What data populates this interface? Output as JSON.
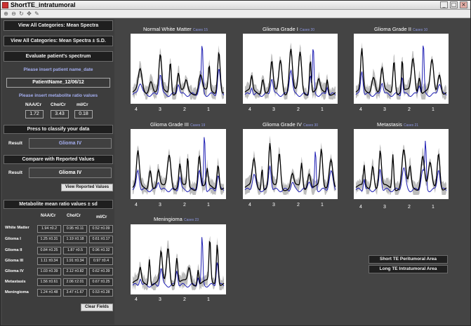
{
  "window": {
    "title": "ShortTE_intratumoral",
    "controls": [
      "_",
      "□",
      "×"
    ]
  },
  "toolbar": {
    "tools": [
      "zoom-in-icon",
      "zoom-out-icon",
      "rotate-icon",
      "pan-icon",
      "data-cursor-icon"
    ],
    "glyphs": [
      "⊕",
      "⊖",
      "↻",
      "✥",
      "✎"
    ]
  },
  "left_panel": {
    "btn_mean_spectra": "View All Categories: Mean Spectra",
    "btn_mean_spectra_sd": "View All Categories: Mean Spectra ± S.D.",
    "btn_evaluate": "Evaluate patient's spectrum",
    "insert_name_label": "Please insert patient name_date",
    "patient_name": "PatientName_12/06/12",
    "insert_ratio_label": "Please insert metabolite ratio values",
    "ratio_headers": [
      "NAA/Cr",
      "Cho/Cr",
      "mI/Cr"
    ],
    "ratio_values": [
      "1.72",
      "3.43",
      "0.18"
    ],
    "btn_classify": "Press to classify your data",
    "result_label": "Result",
    "classify_result": "Glioma IV",
    "btn_compare": "Compare with Reported Values",
    "result_label_2": "Result",
    "compare_result": "Glioma IV",
    "btn_view_reported": "View Reported Values",
    "mean_ratio_header": "Metabolite mean ratio values ± sd",
    "table_headers": [
      "NAA/Cr",
      "Cho/Cr",
      "mI/Cr"
    ],
    "table_rows": [
      {
        "label": "White Matter",
        "values": [
          "1.94 ±0.2",
          "0.95 ±0.11",
          "0.52 ±0.09"
        ]
      },
      {
        "label": "Glioma I",
        "values": [
          "1.25 ±0.31",
          "1.19 ±0.18",
          "0.61 ±0.17"
        ]
      },
      {
        "label": "Glioma II",
        "values": [
          "0.84 ±0.25",
          "1.87 ±0.5",
          "0.96 ±0.32"
        ]
      },
      {
        "label": "Glioma III",
        "values": [
          "1.11 ±0.34",
          "1.91 ±0.34",
          "0.97 ±0.4"
        ]
      },
      {
        "label": "Glioma IV",
        "values": [
          "1.03 ±0.39",
          "2.12 ±0.82",
          "0.62 ±0.39"
        ]
      },
      {
        "label": "Metastasis",
        "values": [
          "1.56 ±0.61",
          "2.06 ±2.01",
          "0.67 ±0.25"
        ]
      },
      {
        "label": "Meningioma",
        "values": [
          "1.24 ±0.48",
          "3.47 ±1.67",
          "0.53 ±0.28"
        ]
      }
    ],
    "btn_clear": "Clear Fields"
  },
  "plots": [
    {
      "title": "Normal White Matter",
      "cases": "Cases 15",
      "ticks": [
        "4",
        "3",
        "2",
        "1"
      ]
    },
    {
      "title": "Glioma Grade I",
      "cases": "Cases 20",
      "ticks": [
        "4",
        "3",
        "2",
        "1"
      ]
    },
    {
      "title": "Glioma Grade II",
      "cases": "Cases 10",
      "ticks": [
        "4",
        "3",
        "2",
        "1"
      ]
    },
    {
      "title": "Glioma Grade III",
      "cases": "Cases 19",
      "ticks": [
        "4",
        "3",
        "2",
        "1"
      ]
    },
    {
      "title": "Glioma Grade IV",
      "cases": "Cases 30",
      "ticks": [
        "4",
        "3",
        "2",
        "1"
      ]
    },
    {
      "title": "Metastasis",
      "cases": "Cases 21",
      "ticks": [
        "4",
        "3",
        "2",
        "1"
      ]
    },
    {
      "title": "Meningioma",
      "cases": "Cases 23",
      "ticks": [
        "4",
        "3",
        "2",
        "1"
      ]
    }
  ],
  "right_buttons": {
    "short_te_peritumoral": "Short TE Peritumoral Area",
    "long_te_intratumoral": "Long TE Intratumoral Area"
  },
  "colors": {
    "background": "#444444",
    "mean_spectrum": "#000000",
    "sd_band": "#bdbdbd",
    "patient_spectrum": "#1f1fb4",
    "accent_text": "#a4aef0"
  }
}
